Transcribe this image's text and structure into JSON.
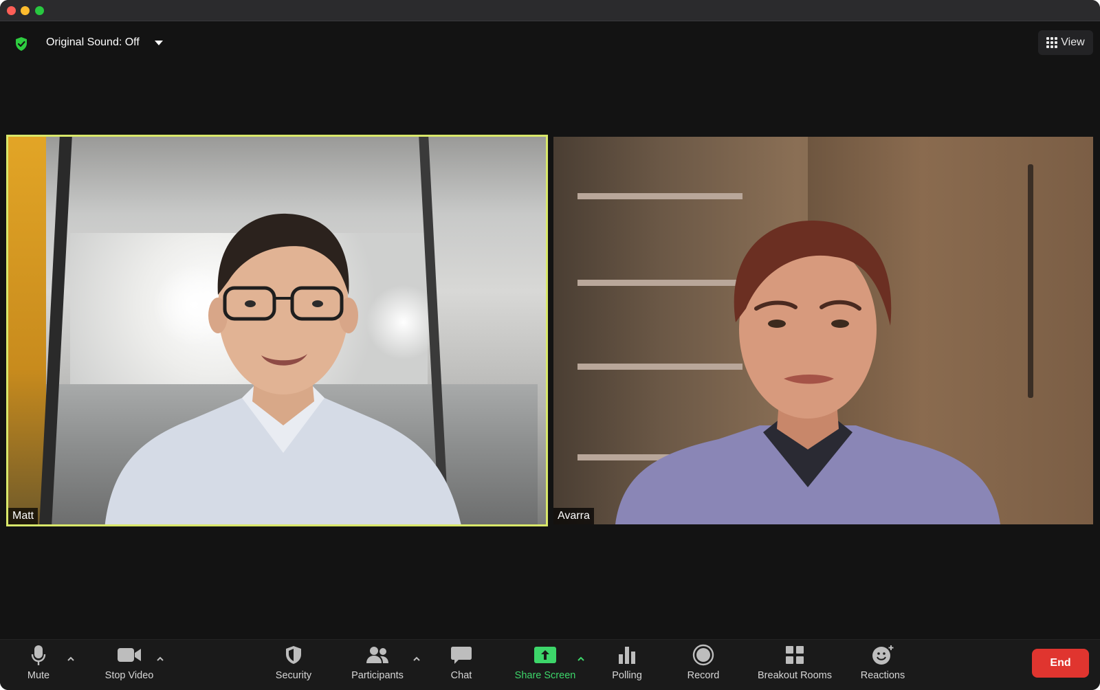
{
  "topbar": {
    "original_sound_label": "Original Sound: Off",
    "view_label": "View"
  },
  "participants": [
    {
      "name": "Matt",
      "active_speaker": true
    },
    {
      "name": "Avarra",
      "active_speaker": false
    }
  ],
  "toolbar": {
    "mute_label": "Mute",
    "stop_video_label": "Stop Video",
    "security_label": "Security",
    "participants_label": "Participants",
    "chat_label": "Chat",
    "share_screen_label": "Share Screen",
    "polling_label": "Polling",
    "record_label": "Record",
    "breakout_rooms_label": "Breakout Rooms",
    "reactions_label": "Reactions",
    "end_label": "End"
  },
  "colors": {
    "active_speaker_border": "#d9e86a",
    "share_screen_green": "#3dd66a",
    "end_red": "#e0352f",
    "shield_green": "#2ecc40"
  }
}
